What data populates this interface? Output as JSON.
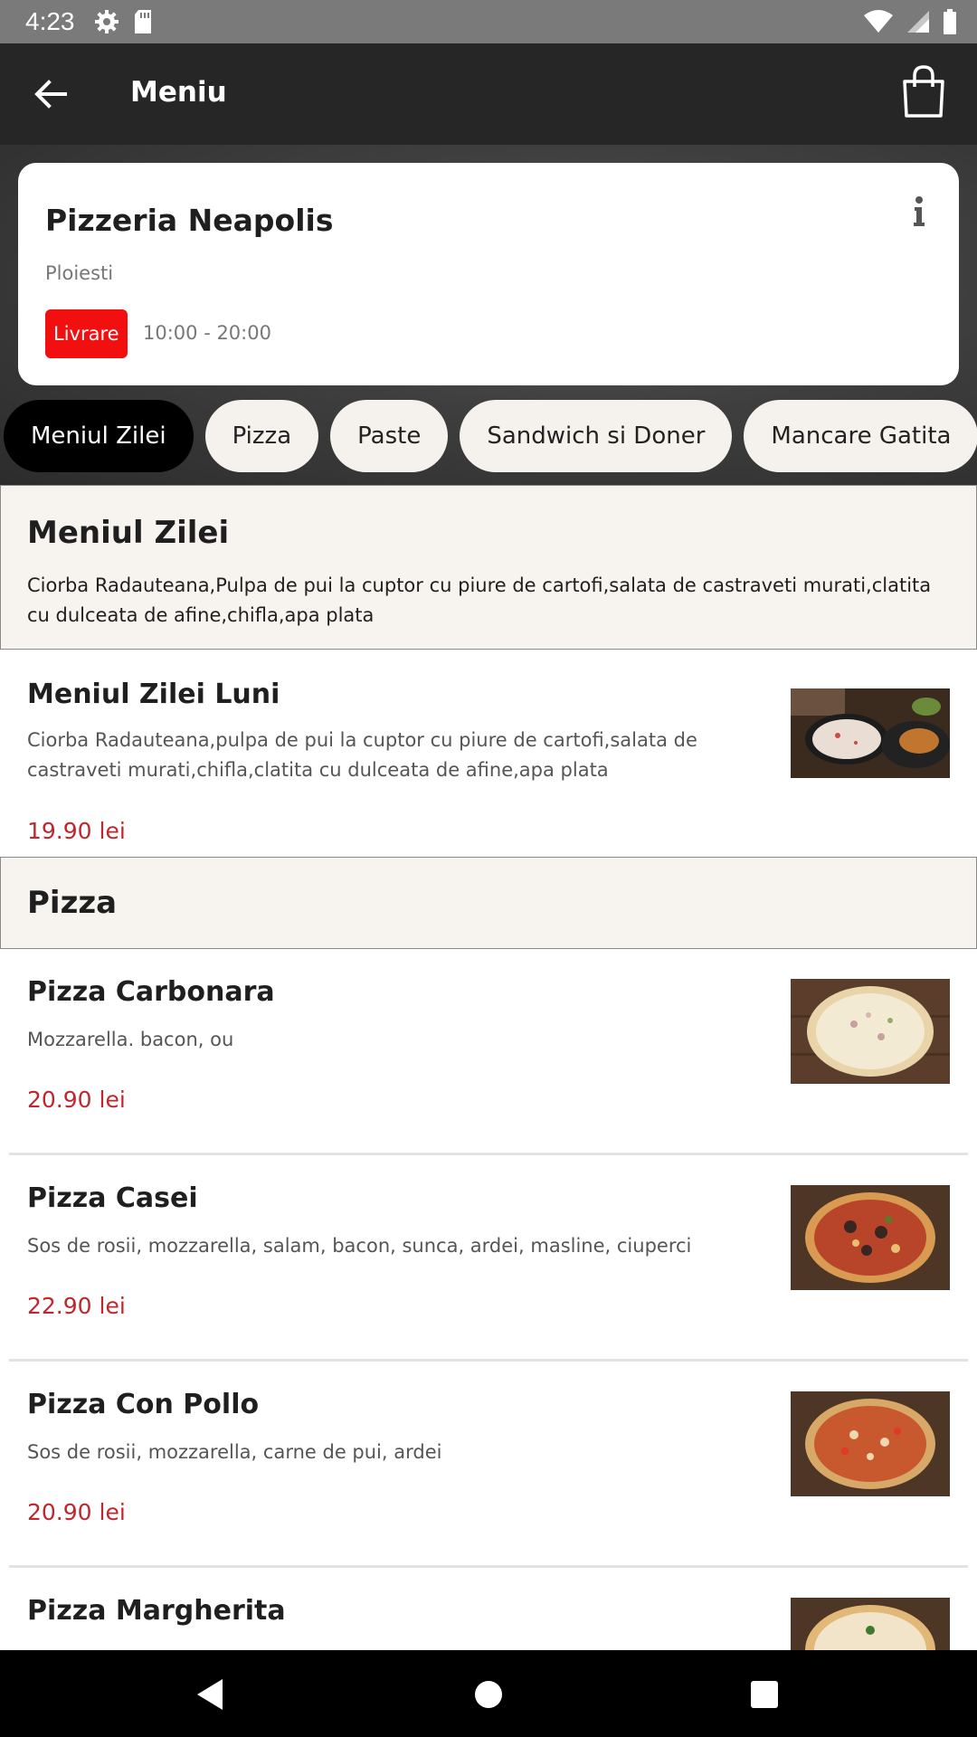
{
  "status_bar": {
    "time": "4:23"
  },
  "app_bar": {
    "title": "Meniu"
  },
  "restaurant": {
    "name": "Pizzeria Neapolis",
    "city": "Ploiesti",
    "delivery_badge": "Livrare",
    "hours": "10:00 - 20:00"
  },
  "tabs": [
    {
      "label": "Meniul Zilei",
      "active": true
    },
    {
      "label": "Pizza",
      "active": false
    },
    {
      "label": "Paste",
      "active": false
    },
    {
      "label": "Sandwich si Doner",
      "active": false
    },
    {
      "label": "Mancare Gatita",
      "active": false
    }
  ],
  "sections": {
    "meniul_zilei": {
      "title": "Meniul Zilei",
      "description": "Ciorba Radauteana,Pulpa de pui la cuptor cu piure de cartofi,salata de castraveti murati,clatita cu dulceata de afine,chifla,apa plata"
    },
    "pizza": {
      "title": "Pizza"
    }
  },
  "items": [
    {
      "name": "Meniul Zilei Luni",
      "description": "Ciorba Radauteana,pulpa de pui la cuptor cu piure de cartofi,salata de castraveti murati,chifla,clatita cu dulceata de afine,apa plata",
      "price": "19.90 lei",
      "image": "daily-menu-photo"
    },
    {
      "name": "Pizza Carbonara",
      "description": "Mozzarella. bacon, ou",
      "price": "20.90 lei",
      "image": "pizza-carbonara-photo"
    },
    {
      "name": "Pizza Casei",
      "description": "Sos de rosii, mozzarella, salam, bacon, sunca, ardei, masline, ciuperci",
      "price": "22.90 lei",
      "image": "pizza-casei-photo"
    },
    {
      "name": "Pizza Con Pollo",
      "description": "Sos de rosii, mozzarella, carne de pui, ardei",
      "price": "20.90 lei",
      "image": "pizza-con-pollo-photo"
    },
    {
      "name": "Pizza Margherita",
      "image": "pizza-margherita-photo"
    }
  ],
  "colors": {
    "app_bar": "#262626",
    "badge": "#f20f0f",
    "price": "#c0272d",
    "section_bg": "#f7f3ef",
    "tab_bg": "#f5f1ed"
  }
}
